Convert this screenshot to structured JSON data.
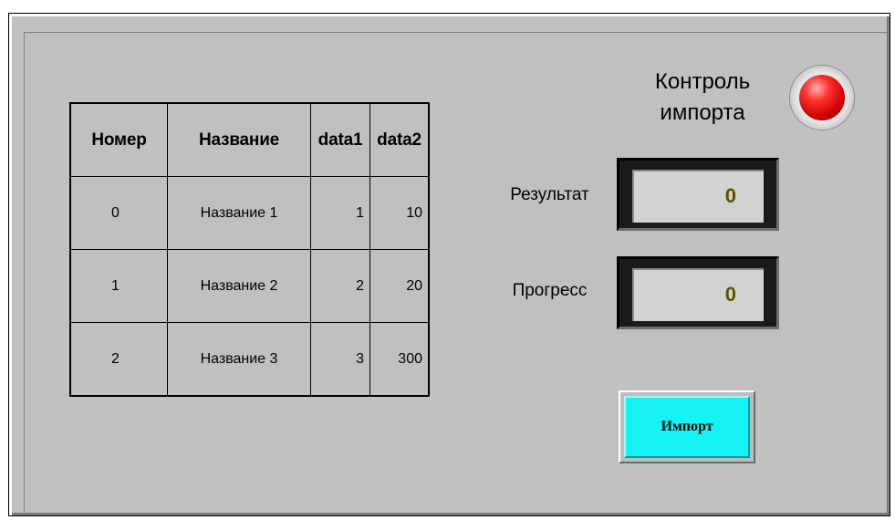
{
  "table": {
    "headers": [
      "Номер",
      "Название",
      "data1",
      "data2"
    ],
    "rows": [
      [
        "0",
        "Название 1",
        "1",
        "10"
      ],
      [
        "1",
        "Название 2",
        "2",
        "20"
      ],
      [
        "2",
        "Название 3",
        "3",
        "300"
      ]
    ]
  },
  "control": {
    "label_line1": "Контроль",
    "label_line2": "импорта",
    "indicator_state": "red"
  },
  "result": {
    "label": "Результат",
    "value": "0"
  },
  "progress": {
    "label": "Прогресс",
    "value": "0"
  },
  "import_button": {
    "label": "Импорт"
  },
  "colors": {
    "background": "#c0c0c0",
    "indicator": "#ff2020",
    "button_face": "#16f3f3",
    "value_text": "#555500"
  }
}
